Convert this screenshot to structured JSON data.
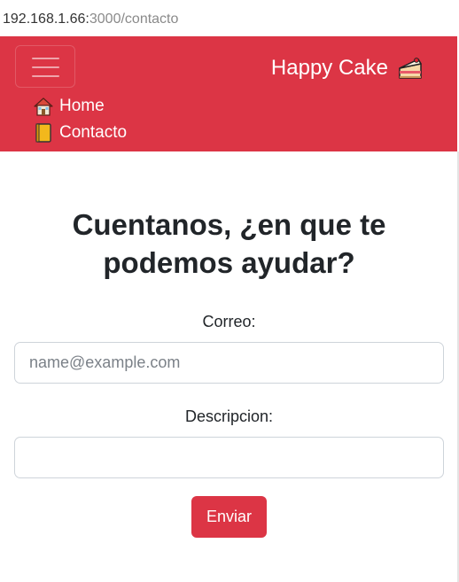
{
  "browser": {
    "url_host": "192.168.1.66:",
    "url_path": "3000/contacto"
  },
  "navbar": {
    "brand_label": "Happy Cake",
    "brand_icon": "cake-icon",
    "toggler_icon": "hamburger-icon",
    "background_color": "#dc3545",
    "links": [
      {
        "label": "Home",
        "icon": "house-icon"
      },
      {
        "label": "Contacto",
        "icon": "notebook-icon"
      }
    ]
  },
  "form": {
    "title": "Cuentanos, ¿en que te podemos ayudar?",
    "email_label": "Correo:",
    "email_placeholder": "name@example.com",
    "email_value": "",
    "description_label": "Descripcion:",
    "description_value": "",
    "submit_label": "Enviar",
    "accent_color": "#dc3545"
  }
}
